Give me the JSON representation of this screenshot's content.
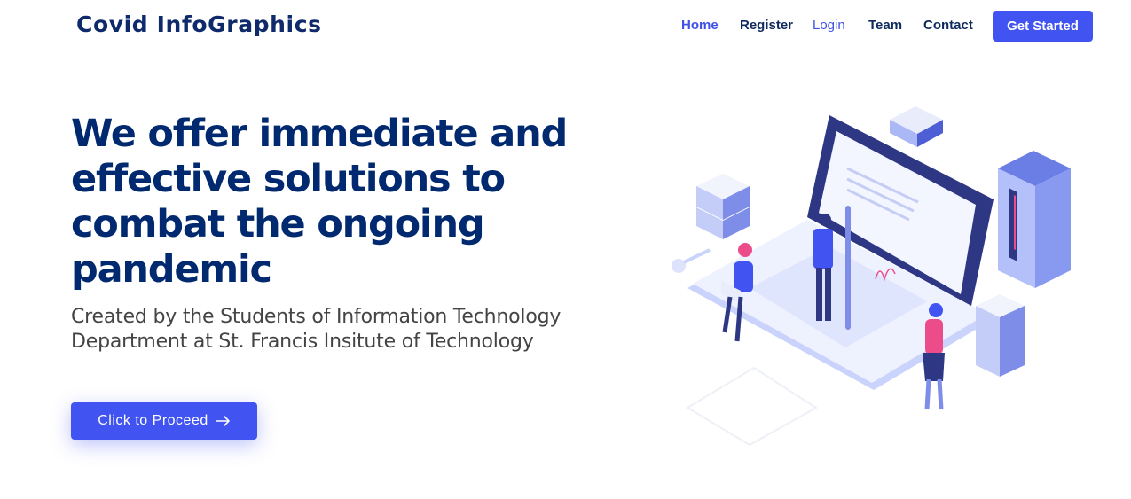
{
  "header": {
    "brand": "Covid InfoGraphics",
    "nav": [
      {
        "label": "Home",
        "active": true
      },
      {
        "label": "Register"
      },
      {
        "label": "Login"
      },
      {
        "label": "Team"
      },
      {
        "label": "Contact"
      }
    ],
    "cta": "Get Started"
  },
  "hero": {
    "title": "We offer immediate and effective solutions to combat the ongoing pandemic",
    "subtitle": "Created by the Students of Information Technology Department at St. Francis Insitute of Technology",
    "button": "Click to Proceed",
    "button_icon": "arrow-right-icon"
  },
  "colors": {
    "primary": "#4154f1",
    "heading": "#012970",
    "text": "#444444"
  }
}
